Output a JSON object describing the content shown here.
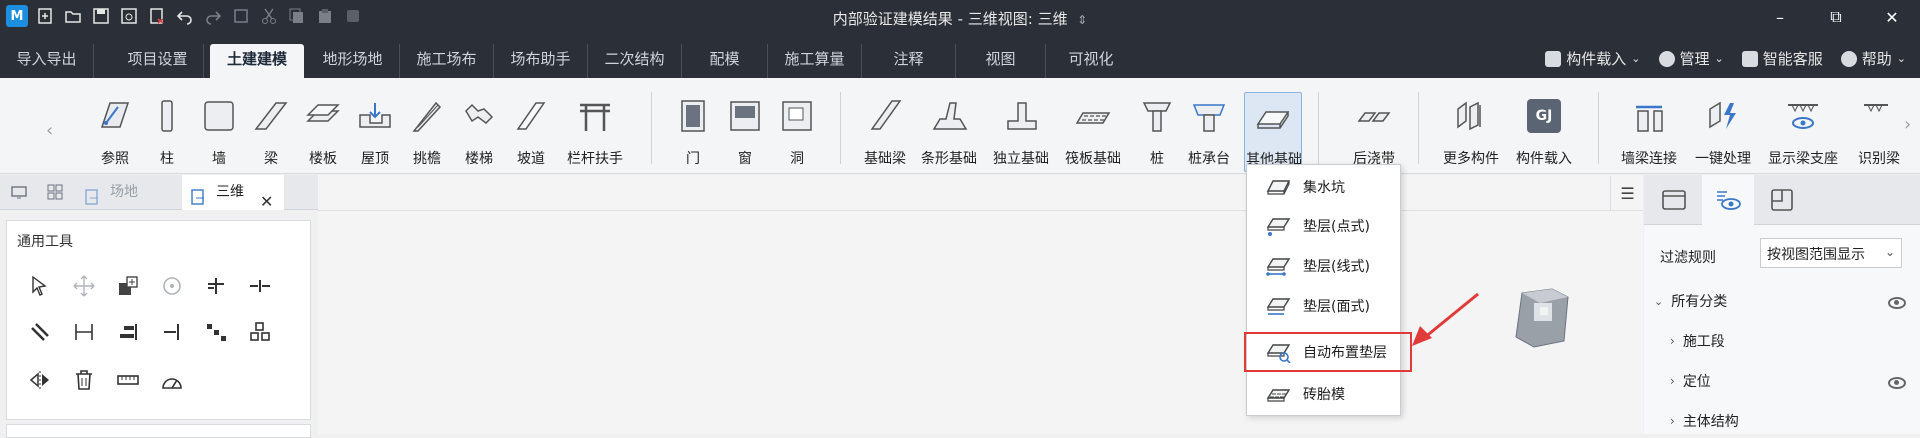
{
  "window": {
    "title": "内部验证建模结果 - 三维视图: 三维",
    "title_caret": "⇕",
    "minimize": "–",
    "maximize": "⧉",
    "close": "✕"
  },
  "menu": {
    "tabs": [
      {
        "label": "导入导出"
      },
      {
        "label": "项目设置"
      },
      {
        "label": "土建建模"
      },
      {
        "label": "地形场地"
      },
      {
        "label": "施工场布"
      },
      {
        "label": "场布助手"
      },
      {
        "label": "二次结构"
      },
      {
        "label": "配模"
      },
      {
        "label": "施工算量"
      },
      {
        "label": "注释"
      },
      {
        "label": "视图"
      },
      {
        "label": "可视化"
      }
    ],
    "active": "土建建模",
    "right": {
      "component_load": "构件载入",
      "manage": "管理",
      "smart_service": "智能客服",
      "help": "帮助"
    }
  },
  "ribbon": {
    "items": [
      {
        "label": "参照"
      },
      {
        "label": "柱"
      },
      {
        "label": "墙"
      },
      {
        "label": "梁"
      },
      {
        "label": "楼板"
      },
      {
        "label": "屋顶"
      },
      {
        "label": "挑檐"
      },
      {
        "label": "楼梯"
      },
      {
        "label": "坡道"
      },
      {
        "label": "栏杆扶手"
      },
      {
        "label": "门"
      },
      {
        "label": "窗"
      },
      {
        "label": "洞"
      },
      {
        "label": "基础梁"
      },
      {
        "label": "条形基础"
      },
      {
        "label": "独立基础"
      },
      {
        "label": "筏板基础"
      },
      {
        "label": "桩"
      },
      {
        "label": "桩承台"
      },
      {
        "label": "其他基础"
      },
      {
        "label": "后浇带"
      },
      {
        "label": "更多构件"
      },
      {
        "label": "构件载入"
      },
      {
        "label": "墙梁连接"
      },
      {
        "label": "一键处理"
      },
      {
        "label": "显示梁支座"
      },
      {
        "label": "识别梁"
      }
    ],
    "gj_badge": "GJ",
    "selected": "其他基础"
  },
  "doc_tabs": {
    "tab_site": "场地",
    "tab_3d": "三维",
    "close": "✕"
  },
  "tools": {
    "title": "通用工具"
  },
  "dropdown": {
    "items": [
      {
        "label": "集水坑"
      },
      {
        "label": "垫层(点式)"
      },
      {
        "label": "垫层(线式)"
      },
      {
        "label": "垫层(面式)"
      },
      {
        "label": "自动布置垫层"
      },
      {
        "label": "砖胎模"
      }
    ],
    "highlighted": "自动布置垫层"
  },
  "right_panel": {
    "filter_label": "过滤规则",
    "filter_value": "按视图范围显示",
    "tree": [
      {
        "label": "所有分类",
        "expanded": true,
        "level": 0
      },
      {
        "label": "施工段",
        "expanded": false,
        "level": 1
      },
      {
        "label": "定位",
        "expanded": false,
        "level": 1
      },
      {
        "label": "主体结构",
        "expanded": false,
        "level": 1
      }
    ]
  },
  "colors": {
    "titlebar": "#2b2f38",
    "ribbon_bg": "#f4f5f7",
    "selection": "#dde7f3",
    "annotation_red": "#e03a3a",
    "accent_blue": "#1d8fe1"
  }
}
